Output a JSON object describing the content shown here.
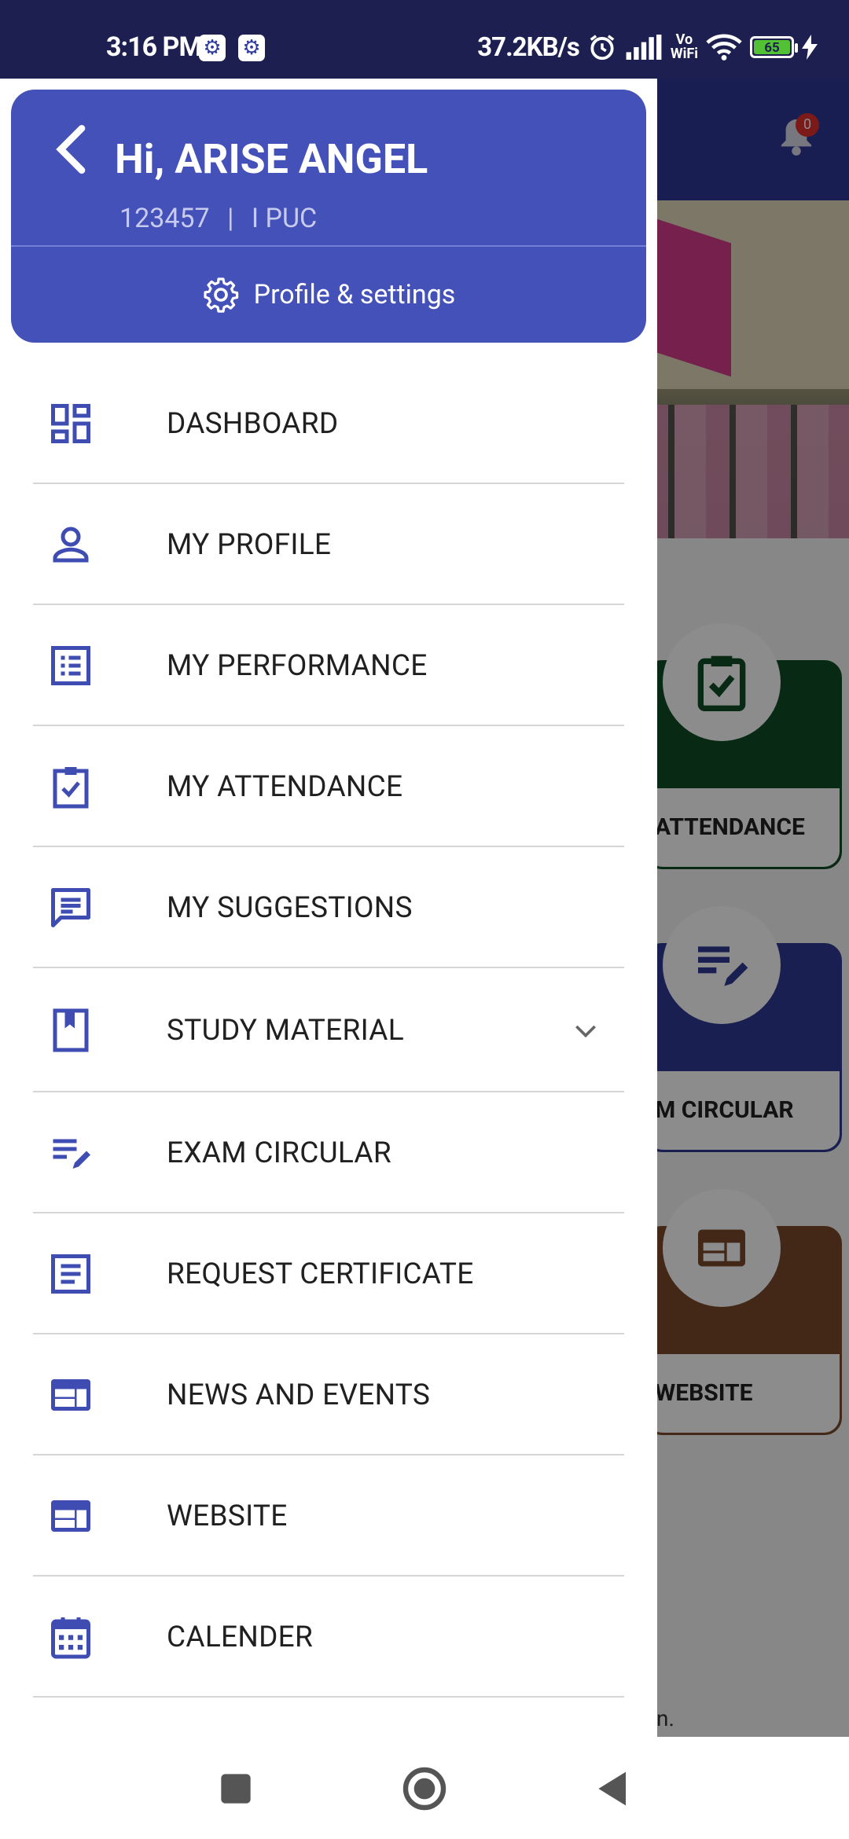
{
  "status_bar": {
    "time": "3:16 PM",
    "network_speed": "37.2KB/s",
    "vowifi_top": "Vo",
    "vowifi_bottom": "WiFi",
    "battery": "65",
    "icons": [
      "settings-app-icon",
      "settings-app-icon",
      "alarm-icon",
      "signal-icon",
      "wifi-icon",
      "battery-icon",
      "charging-icon"
    ]
  },
  "background_app": {
    "notification_count": "0",
    "tiles": [
      {
        "label": "ATTENDANCE",
        "color": "#0f4d26",
        "icon": "clipboard-check-icon"
      },
      {
        "label": "M CIRCULAR",
        "color": "#2e3a93",
        "icon": "edit-notes-icon"
      },
      {
        "label": "WEBSITE",
        "color": "#7a4a2a",
        "icon": "web-icon"
      }
    ],
    "footer_fragment": "n."
  },
  "drawer": {
    "greeting": "Hi, ARISE ANGEL",
    "student_id": "123457",
    "separator": "|",
    "class": "I PUC",
    "profile_settings_label": "Profile & settings",
    "header_color": "#4351b9",
    "items": [
      {
        "label": "DASHBOARD",
        "icon": "dashboard-icon"
      },
      {
        "label": "MY PROFILE",
        "icon": "person-icon"
      },
      {
        "label": "MY PERFORMANCE",
        "icon": "list-alt-icon"
      },
      {
        "label": "MY ATTENDANCE",
        "icon": "clipboard-check-icon"
      },
      {
        "label": "MY SUGGESTIONS",
        "icon": "chat-icon"
      },
      {
        "label": "STUDY MATERIAL",
        "icon": "book-icon"
      },
      {
        "label": "EXAM CIRCULAR",
        "icon": "edit-notes-icon"
      },
      {
        "label": "REQUEST CERTIFICATE",
        "icon": "article-icon"
      },
      {
        "label": "NEWS AND EVENTS",
        "icon": "web-icon"
      },
      {
        "label": "WEBSITE",
        "icon": "web-icon"
      },
      {
        "label": "CALENDER",
        "icon": "calendar-icon"
      }
    ]
  },
  "nav_bar": {
    "buttons": [
      "recents-button",
      "home-button",
      "back-button"
    ]
  }
}
